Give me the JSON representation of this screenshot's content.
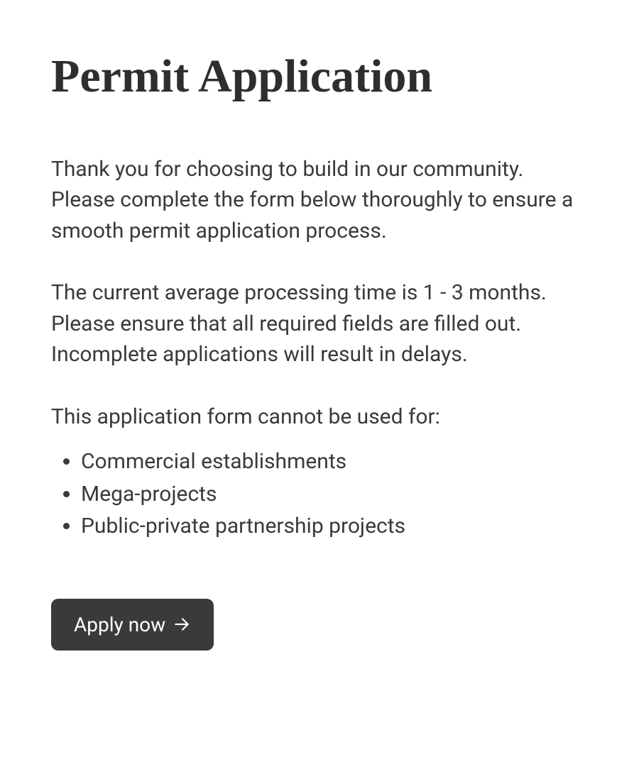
{
  "title": "Permit Application",
  "paragraphs": [
    "Thank you for choosing to build in our community. Please complete the form below thoroughly to ensure a smooth permit application process.",
    "The current average processing time is 1 - 3 months. Please ensure that all required fields are filled out. Incomplete applications will result in delays."
  ],
  "exclusion_heading": "This application form cannot be used for:",
  "exclusion_items": [
    "Commercial establishments",
    "Mega-projects",
    "Public-private partnership projects"
  ],
  "cta_label": "Apply now"
}
